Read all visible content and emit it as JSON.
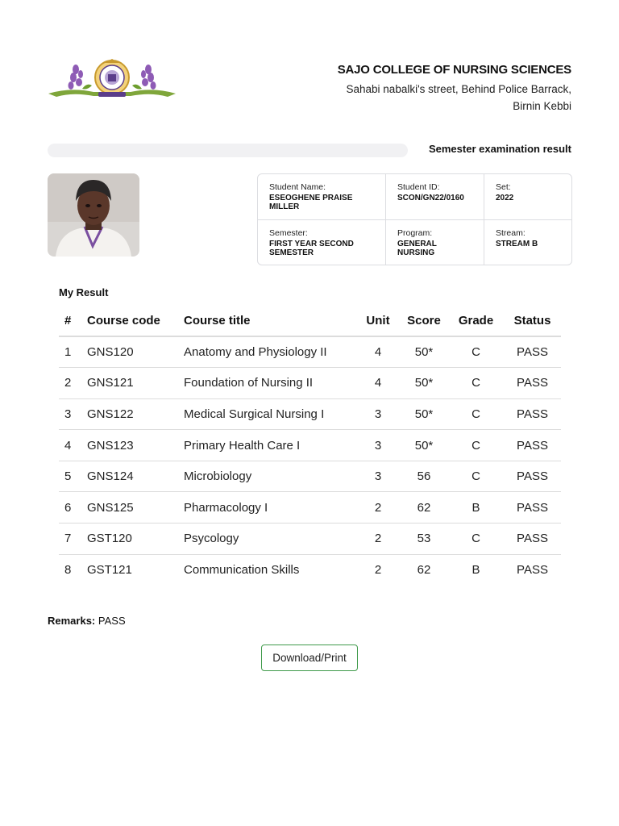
{
  "header": {
    "college_name": "SAJO COLLEGE OF NURSING SCIENCES",
    "address_line1": "Sahabi nabalki's street, Behind Police Barrack,",
    "address_line2": "Birnin Kebbi"
  },
  "page_title": "Semester examination result",
  "student": {
    "name_label": "Student Name:",
    "name": "ESEOGHENE PRAISE MILLER",
    "id_label": "Student ID:",
    "id": "SCON/GN22/0160",
    "set_label": "Set:",
    "set": "2022",
    "semester_label": "Semester:",
    "semester": "FIRST YEAR SECOND SEMESTER",
    "program_label": "Program:",
    "program": "GENERAL NURSING",
    "stream_label": "Stream:",
    "stream": "STREAM B"
  },
  "results": {
    "heading": "My Result",
    "columns": [
      "#",
      "Course code",
      "Course title",
      "Unit",
      "Score",
      "Grade",
      "Status"
    ],
    "rows": [
      [
        "1",
        "GNS120",
        "Anatomy and Physiology II",
        "4",
        "50*",
        "C",
        "PASS"
      ],
      [
        "2",
        "GNS121",
        "Foundation of Nursing II",
        "4",
        "50*",
        "C",
        "PASS"
      ],
      [
        "3",
        "GNS122",
        "Medical Surgical Nursing I",
        "3",
        "50*",
        "C",
        "PASS"
      ],
      [
        "4",
        "GNS123",
        "Primary Health Care I",
        "3",
        "50*",
        "C",
        "PASS"
      ],
      [
        "5",
        "GNS124",
        "Microbiology",
        "3",
        "56",
        "C",
        "PASS"
      ],
      [
        "6",
        "GNS125",
        "Pharmacology I",
        "2",
        "62",
        "B",
        "PASS"
      ],
      [
        "7",
        "GST120",
        "Psycology",
        "2",
        "53",
        "C",
        "PASS"
      ],
      [
        "8",
        "GST121",
        "Communication Skills",
        "2",
        "62",
        "B",
        "PASS"
      ]
    ]
  },
  "remarks": {
    "label": "Remarks:",
    "value": "PASS"
  },
  "download_label": "Download/Print",
  "colors": {
    "button_border": "#3f9a4a",
    "logo_purple": "#8e5bb5",
    "logo_green": "#7fa63b"
  }
}
